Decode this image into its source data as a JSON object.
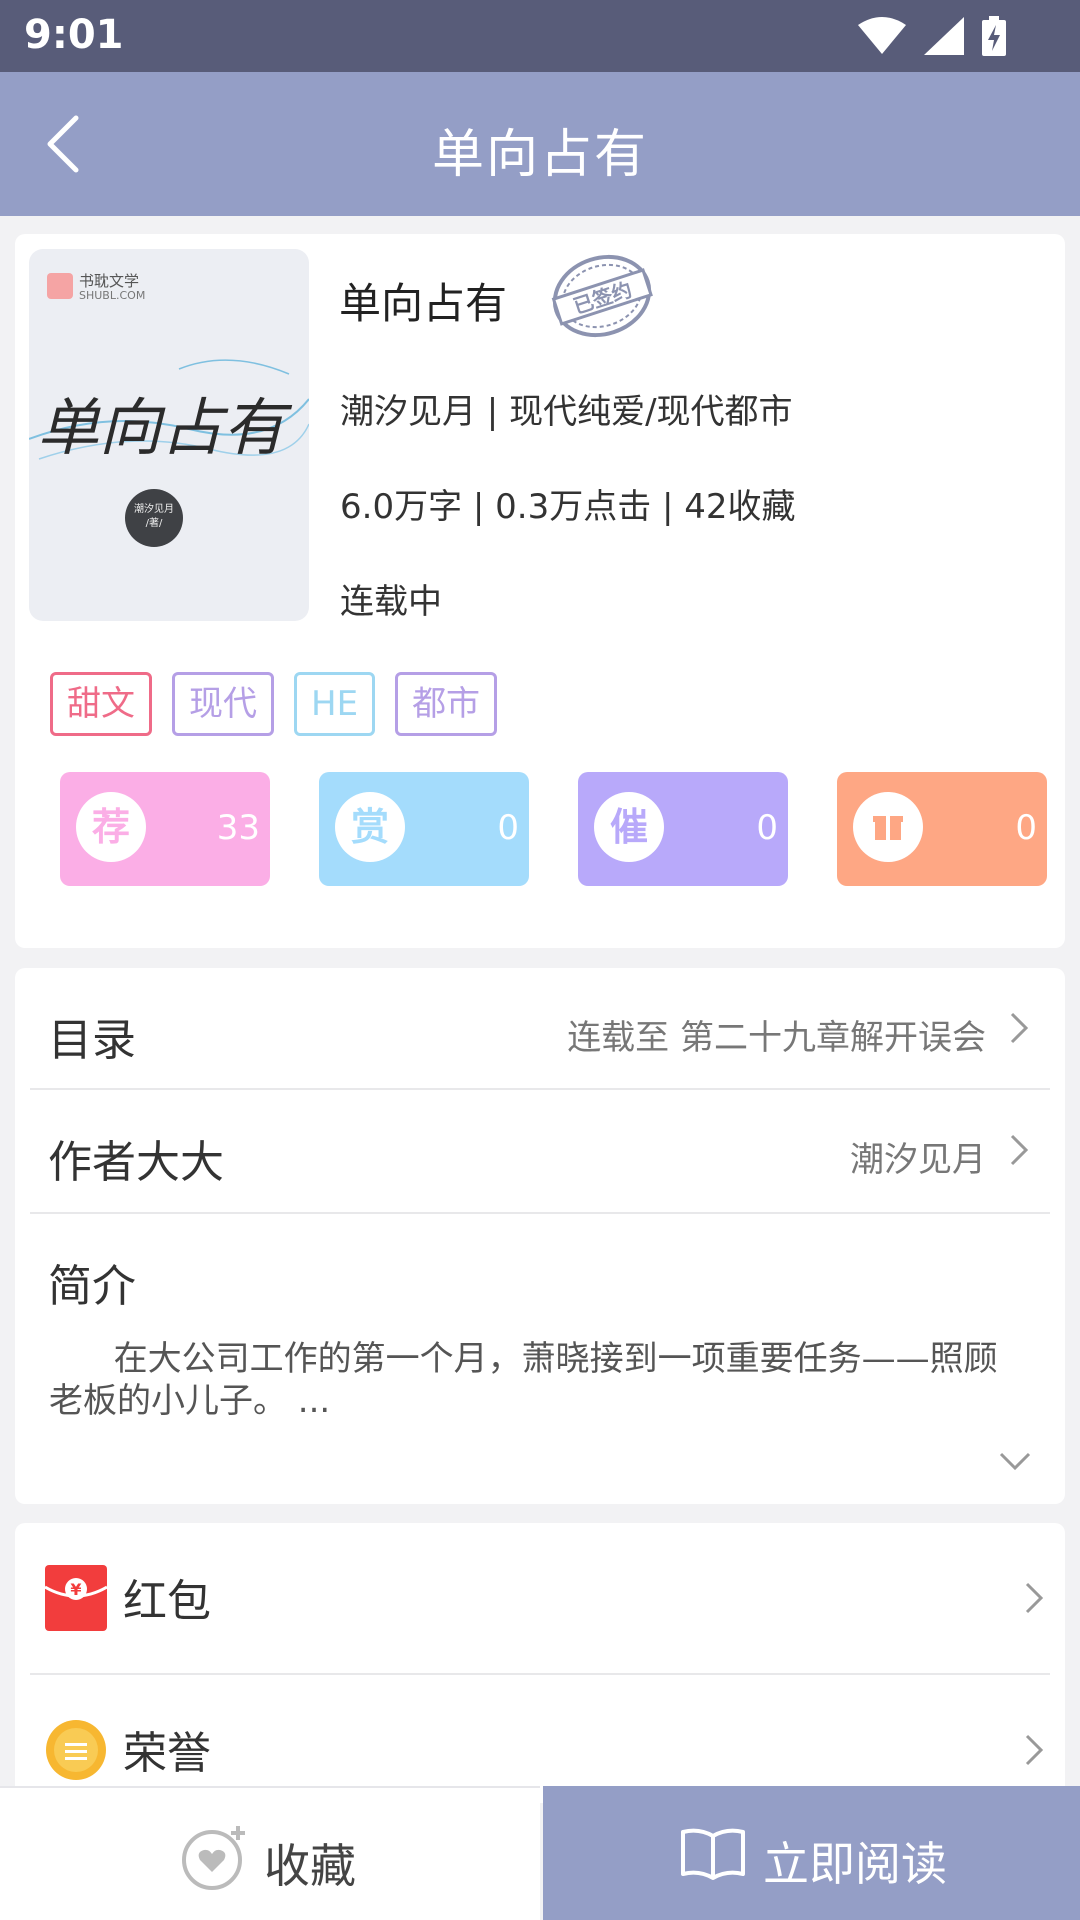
{
  "status_bar": {
    "time": "9:01"
  },
  "header": {
    "title": "单向占有"
  },
  "book": {
    "title": "单向占有",
    "signed_badge": "已签约",
    "author_category": "潮汐见月 | 现代纯爱/现代都市",
    "stats_line": "6.0万字 | 0.3万点击 | 42收藏",
    "status": "连载中",
    "cover": {
      "brand": "书耽文学",
      "brand_sub": "SHUBL.COM",
      "title_art": "单向占有",
      "author": "潮汐见月",
      "author_suffix": "/著/"
    }
  },
  "tags": [
    {
      "label": "甜文",
      "color": "#ef6b88"
    },
    {
      "label": "现代",
      "color": "#b59fe6"
    },
    {
      "label": "HE",
      "color": "#9dd7f2"
    },
    {
      "label": "都市",
      "color": "#b59fe6"
    }
  ],
  "stat_buttons": [
    {
      "icon_char": "荐",
      "value": "33",
      "color": "#fbaee6",
      "icon_color": "#fbaee6"
    },
    {
      "icon_char": "赏",
      "value": "0",
      "color": "#a4dcfc",
      "icon_color": "#a4dcfc"
    },
    {
      "icon_char": "催",
      "value": "0",
      "color": "#b8a9fa",
      "icon_color": "#b8a9fa"
    },
    {
      "icon_char": "",
      "icon_name": "gift-box-icon",
      "value": "0",
      "color": "#fea784",
      "icon_color": "#fea784"
    }
  ],
  "info": {
    "catalog_label": "目录",
    "catalog_value": "连载至 第二十九章解开误会",
    "author_label": "作者大大",
    "author_value": "潮汐见月",
    "intro_label": "简介",
    "intro_text": "在大公司工作的第一个月，萧晓接到一项重要任务——照顾老板的小儿子。 ..."
  },
  "extras": {
    "red_packet_label": "红包",
    "honor_label": "荣誉"
  },
  "bottom": {
    "favorite_label": "收藏",
    "read_label": "立即阅读"
  },
  "colors": {
    "header": "#949ec6",
    "status_bar": "#585c79",
    "read_button": "#949ec6"
  }
}
